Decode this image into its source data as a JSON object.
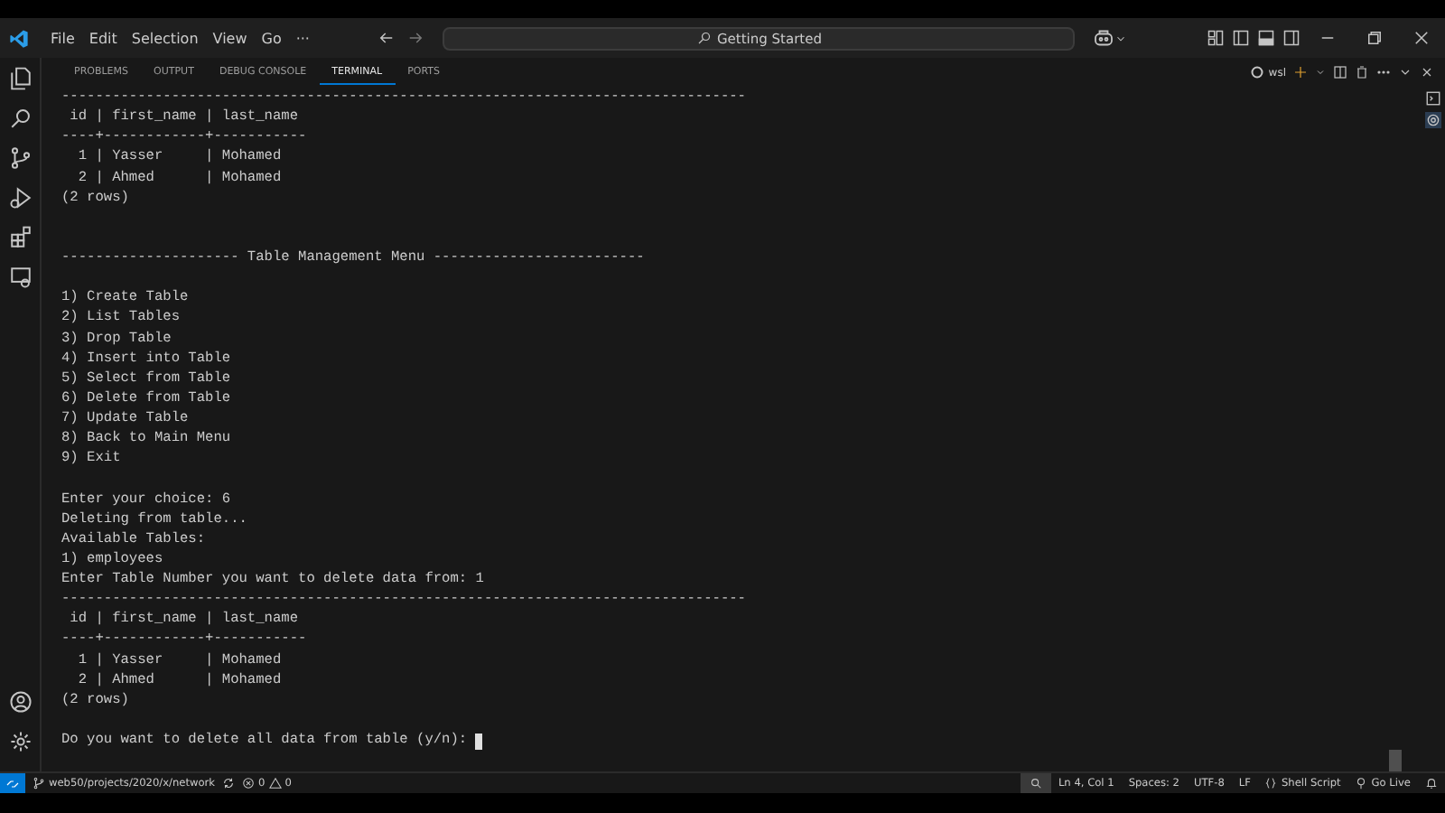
{
  "menu": [
    "File",
    "Edit",
    "Selection",
    "View",
    "Go",
    "···"
  ],
  "command_center": {
    "value": "Getting Started"
  },
  "panel_tabs": [
    {
      "label": "PROBLEMS",
      "selected": false
    },
    {
      "label": "OUTPUT",
      "selected": false
    },
    {
      "label": "DEBUG CONSOLE",
      "selected": false
    },
    {
      "label": "TERMINAL",
      "selected": true
    },
    {
      "label": "PORTS",
      "selected": false
    }
  ],
  "terminal_profile": "wsl",
  "terminal_lines": [
    {
      "kind": "output",
      "text": "---------------------------------------------------------------------------------"
    },
    {
      "kind": "output",
      "text": " id | first_name | last_name"
    },
    {
      "kind": "output",
      "text": "----+------------+-----------"
    },
    {
      "kind": "output",
      "text": "  1 | Yasser     | Mohamed"
    },
    {
      "kind": "output",
      "text": "  2 | Ahmed      | Mohamed"
    },
    {
      "kind": "output",
      "text": "(2 rows)"
    },
    {
      "kind": "blank"
    },
    {
      "kind": "blank"
    },
    {
      "kind": "output",
      "text": "--------------------- Table Management Menu -------------------------"
    },
    {
      "kind": "blank"
    },
    {
      "kind": "output",
      "text": "1) Create Table"
    },
    {
      "kind": "output",
      "text": "2) List Tables"
    },
    {
      "kind": "output",
      "text": "3) Drop Table"
    },
    {
      "kind": "output",
      "text": "4) Insert into Table"
    },
    {
      "kind": "output",
      "text": "5) Select from Table"
    },
    {
      "kind": "output",
      "text": "6) Delete from Table"
    },
    {
      "kind": "output",
      "text": "7) Update Table"
    },
    {
      "kind": "output",
      "text": "8) Back to Main Menu"
    },
    {
      "kind": "output",
      "text": "9) Exit"
    },
    {
      "kind": "blank"
    },
    {
      "kind": "output",
      "text": "Enter your choice: 6"
    },
    {
      "kind": "output",
      "text": "Deleting from table..."
    },
    {
      "kind": "output",
      "text": "Available Tables:"
    },
    {
      "kind": "output",
      "text": "1) employees"
    },
    {
      "kind": "output",
      "text": "Enter Table Number you want to delete data from: 1"
    },
    {
      "kind": "output",
      "text": "---------------------------------------------------------------------------------"
    },
    {
      "kind": "output",
      "text": " id | first_name | last_name"
    },
    {
      "kind": "output",
      "text": "----+------------+-----------"
    },
    {
      "kind": "output",
      "text": "  1 | Yasser     | Mohamed"
    },
    {
      "kind": "output",
      "text": "  2 | Ahmed      | Mohamed"
    },
    {
      "kind": "output",
      "text": "(2 rows)"
    },
    {
      "kind": "blank"
    },
    {
      "kind": "prompt",
      "text": "Do you want to delete all data from table (y/n): "
    }
  ],
  "status_bar": {
    "branch": "web50/projects/2020/x/network",
    "errors": "0",
    "warnings": "0",
    "position": "Ln 4, Col 1",
    "spaces": "Spaces: 2",
    "encoding": "UTF-8",
    "eol": "LF",
    "language": "Shell Script",
    "live": "Go Live"
  }
}
